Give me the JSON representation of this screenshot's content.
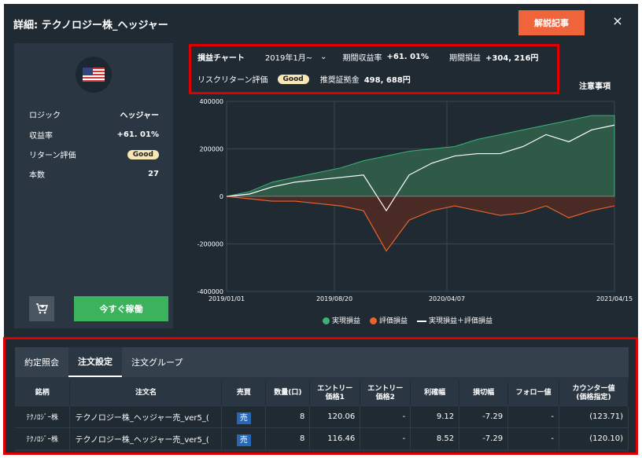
{
  "modal": {
    "title": "詳細: テクノロジー株_ヘッジャー",
    "article_button": "解説記事",
    "close_label": "×"
  },
  "left": {
    "rows": [
      {
        "label": "ロジック",
        "value": "ヘッジャー"
      },
      {
        "label": "収益率",
        "value": "+61. 01%"
      },
      {
        "label": "リターン評価",
        "value": "Good"
      },
      {
        "label": "本数",
        "value": "27"
      }
    ],
    "cart_icon": "cart-plus-icon",
    "run_button": "今すぐ稼働"
  },
  "header": {
    "chart_label": "損益チャート",
    "period_select": "2019年1月~",
    "return_label": "期間収益率",
    "return_value": "+61. 01%",
    "pl_label": "期間損益",
    "pl_value": "+304, 216円",
    "risk_label": "リスクリターン評価",
    "risk_badge": "Good",
    "margin_label": "推奨証拠金",
    "margin_value": "498, 688円",
    "note": "注意事項"
  },
  "chart_data": {
    "type": "area",
    "y_ticks": [
      "400000",
      "200000",
      "0",
      "-200000",
      "-400000"
    ],
    "x_ticks": [
      "2019/01/01",
      "2019/08/20",
      "2020/04/07",
      "2021/04/15"
    ],
    "ylim": [
      -400000,
      400000
    ],
    "grid": true,
    "legend_position": "bottom",
    "series": [
      {
        "name": "実現損益",
        "color": "#3cb27a",
        "values": [
          0,
          20000,
          60000,
          80000,
          100000,
          120000,
          150000,
          170000,
          190000,
          200000,
          210000,
          240000,
          260000,
          280000,
          300000,
          320000,
          340000,
          340000
        ]
      },
      {
        "name": "評価損益",
        "color": "#e8642c",
        "values": [
          0,
          -10000,
          -20000,
          -20000,
          -30000,
          -40000,
          -60000,
          -230000,
          -100000,
          -60000,
          -40000,
          -60000,
          -80000,
          -70000,
          -40000,
          -90000,
          -60000,
          -40000
        ]
      },
      {
        "name": "実現損益＋評価損益",
        "color": "#ffffff",
        "values": [
          0,
          10000,
          40000,
          60000,
          70000,
          80000,
          90000,
          -60000,
          90000,
          140000,
          170000,
          180000,
          180000,
          210000,
          260000,
          230000,
          280000,
          300000
        ]
      }
    ]
  },
  "bottom": {
    "tabs": [
      "約定照会",
      "注文設定",
      "注文グループ"
    ],
    "headers": [
      "銘柄",
      "注文名",
      "売買",
      "数量(口)",
      "エントリー\n価格1",
      "エントリー\n価格2",
      "利確幅",
      "損切幅",
      "フォロー値",
      "カウンター値\n(価格指定)"
    ],
    "rows": [
      [
        "ﾃｸﾉﾛｼﾞｰ株",
        "テクノロジー株_ヘッジャー売_ver5_(",
        "売",
        "8",
        "120.06",
        "-",
        "9.12",
        "-7.29",
        "-",
        "(123.71)"
      ],
      [
        "ﾃｸﾉﾛｼﾞｰ株",
        "テクノロジー株_ヘッジャー売_ver5_(",
        "売",
        "8",
        "116.46",
        "-",
        "8.52",
        "-7.29",
        "-",
        "(120.10)"
      ]
    ]
  }
}
